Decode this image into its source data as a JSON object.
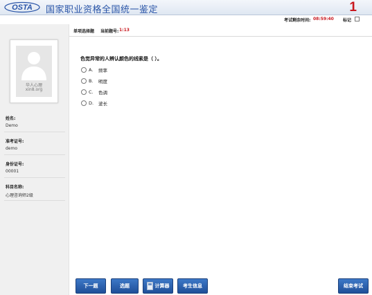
{
  "header": {
    "logo_text": "OSTA",
    "title": "国家职业资格全国统一鉴定",
    "question_number_big": "1"
  },
  "timer": {
    "label": "考试剩余时间:",
    "value": "08:59:40",
    "mark_label": "标记"
  },
  "sidebar": {
    "photo_watermark": [
      "华人心理",
      "xin8.org"
    ],
    "fields": [
      {
        "label": "姓名:",
        "value": "Demo"
      },
      {
        "label": "准考证号:",
        "value": "demo"
      },
      {
        "label": "身份证号:",
        "value": "00001"
      },
      {
        "label": "科目名称:",
        "value": "心理咨询师2级"
      }
    ]
  },
  "main": {
    "question_type": "单项选择题",
    "current_label": "当前题号:",
    "current_value": "1:13",
    "question": "色觉异常的人辨认颜色的线索是（     ）。",
    "options": [
      {
        "letter": "A.",
        "text": "频率"
      },
      {
        "letter": "B.",
        "text": "明度"
      },
      {
        "letter": "C.",
        "text": "色调"
      },
      {
        "letter": "D.",
        "text": "波长"
      }
    ]
  },
  "toolbar": {
    "next_label": "下一题",
    "select_label": "选题",
    "calculator_label": "计算器",
    "info_label": "考生信息",
    "finish_label": "结束考试"
  },
  "colors": {
    "accent_blue": "#2a55a8",
    "button_blue": "#1f4f98",
    "alert_red": "#c8161d"
  }
}
